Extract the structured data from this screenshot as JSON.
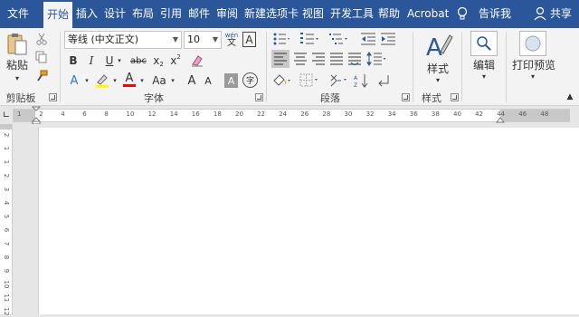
{
  "menu": {
    "tabs": [
      "文件",
      "开始",
      "插入",
      "设计",
      "布局",
      "引用",
      "邮件",
      "审阅",
      "新建选项卡",
      "视图",
      "开发工具",
      "帮助",
      "Acrobat"
    ],
    "active": "开始",
    "tell_me": "告诉我",
    "share": "共享"
  },
  "clipboard": {
    "paste_label": "粘贴",
    "group_label": "剪贴板"
  },
  "font": {
    "font_name": "等线 (中文正文)",
    "font_size": "10",
    "wen_label": "wén",
    "wen_char": "文",
    "a_box": "A",
    "bold": "B",
    "italic": "I",
    "underline": "U",
    "strike": "abc",
    "subscript": "x",
    "sub_mark": "2",
    "superscript": "x",
    "sup_mark": "2",
    "font_color_a": "A",
    "change_case": "Aa",
    "grow": "A",
    "shrink": "A",
    "char_shade": "A",
    "enclose": "字",
    "group_label": "字体"
  },
  "paragraph": {
    "group_label": "段落"
  },
  "styles": {
    "label": "样式",
    "group_label": "样式"
  },
  "editing": {
    "label": "编辑"
  },
  "print_preview": {
    "label": "打印预览"
  },
  "colors": {
    "brand": "#2b579a",
    "highlight_yellow": "#ffff00",
    "font_red": "#ff0000"
  },
  "ruler": {
    "h_marks": [
      "1",
      "2",
      "4",
      "6",
      "8",
      "10",
      "12",
      "14",
      "16",
      "18",
      "20",
      "22",
      "24",
      "26",
      "28",
      "30",
      "32",
      "34",
      "36",
      "38",
      "40",
      "42",
      "44",
      "46",
      "48"
    ],
    "v_marks": [
      "2",
      "1",
      "1",
      "2",
      "3",
      "4",
      "5",
      "6",
      "7",
      "8",
      "9",
      "10",
      "11",
      "12"
    ]
  }
}
